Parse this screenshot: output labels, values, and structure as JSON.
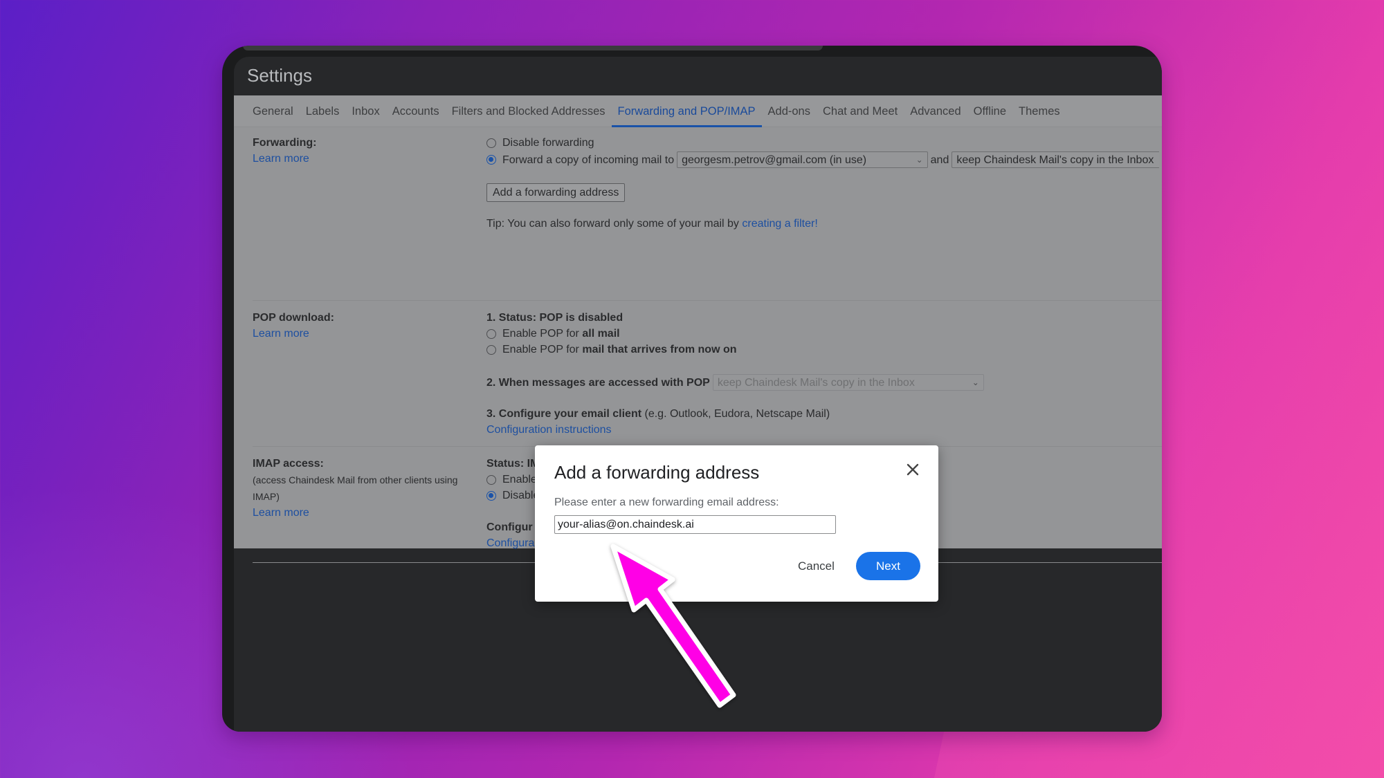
{
  "window": {
    "title": "Settings"
  },
  "tabs": [
    {
      "label": "General"
    },
    {
      "label": "Labels"
    },
    {
      "label": "Inbox"
    },
    {
      "label": "Accounts"
    },
    {
      "label": "Filters and Blocked Addresses"
    },
    {
      "label": "Forwarding and POP/IMAP",
      "active": true
    },
    {
      "label": "Add-ons"
    },
    {
      "label": "Chat and Meet"
    },
    {
      "label": "Advanced"
    },
    {
      "label": "Offline"
    },
    {
      "label": "Themes"
    }
  ],
  "forwarding": {
    "title": "Forwarding:",
    "learn_more": "Learn more",
    "disable_label": "Disable forwarding",
    "forward_label": "Forward a copy of incoming mail to",
    "forward_selected": true,
    "address_select": "georgesm.petrov@gmail.com (in use)",
    "and_text": "and",
    "action_select": "keep Chaindesk Mail's copy in the Inbox",
    "add_button": "Add a forwarding address",
    "tip_text": "Tip: You can also forward only some of your mail by",
    "tip_link": "creating a filter!"
  },
  "pop": {
    "title": "POP download:",
    "learn_more": "Learn more",
    "status": "1. Status: POP is disabled",
    "option1_prefix": "Enable POP for",
    "option1_bold": "all mail",
    "option2_prefix": "Enable POP for",
    "option2_bold": "mail that arrives from now on",
    "step2_label": "2. When messages are accessed with POP",
    "step2_select": "keep Chaindesk Mail's copy in the Inbox",
    "step3_bold": "3. Configure your email client",
    "step3_rest": "(e.g. Outlook, Eudora, Netscape Mail)",
    "config_link": "Configuration instructions"
  },
  "imap": {
    "title": "IMAP access:",
    "subtitle_line1": "(access Chaindesk Mail from other clients using",
    "subtitle_line2": "IMAP)",
    "learn_more": "Learn more",
    "status": "Status: IMAP is disabled",
    "enable_label": "Enable IMAP",
    "disable_label": "Disable IMAP",
    "disable_selected": true,
    "configure_partial": "Configur",
    "config_link_partial": "Configura"
  },
  "dialog": {
    "title": "Add a forwarding address",
    "prompt": "Please enter a new forwarding email address:",
    "input_value": "your-alias@on.chaindesk.ai",
    "cancel_label": "Cancel",
    "next_label": "Next"
  },
  "colors": {
    "accent": "#1a73e8",
    "link": "#1d4fa0",
    "annotation_arrow": "#ff00e6"
  }
}
